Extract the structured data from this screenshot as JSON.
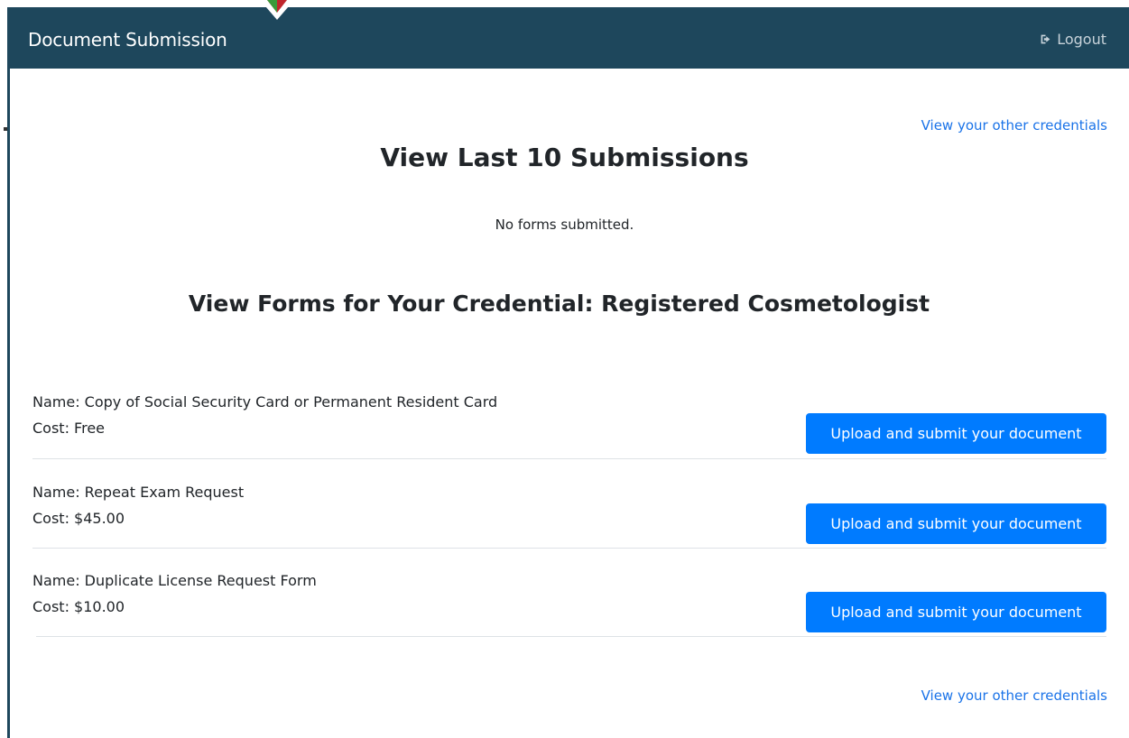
{
  "header": {
    "title": "Document Submission",
    "logout_label": "Logout"
  },
  "links": {
    "other_credentials_top": "View your other credentials",
    "other_credentials_bottom": "View your other credentials"
  },
  "submissions": {
    "heading": "View Last 10 Submissions",
    "empty_message": "No forms submitted."
  },
  "forms": {
    "heading": "View Forms for Your Credential: Registered Cosmetologist",
    "items": [
      {
        "name": "Name: Copy of Social Security Card or Permanent Resident Card",
        "cost": "Cost: Free",
        "button_label": "Upload and submit your document"
      },
      {
        "name": "Name: Repeat Exam Request",
        "cost": "Cost: $45.00",
        "button_label": "Upload and submit your document"
      },
      {
        "name": "Name: Duplicate License Request Form",
        "cost": "Cost: $10.00",
        "button_label": "Upload and submit your document"
      }
    ]
  },
  "colors": {
    "navbar": "#1e475c",
    "primary_button": "#007bff",
    "link": "#1a73e8",
    "logo_green": "#3a9a3a",
    "logo_red": "#c0262d"
  },
  "icons": {
    "logout": "sign-out-icon",
    "logo": "diamond-logo-icon"
  }
}
